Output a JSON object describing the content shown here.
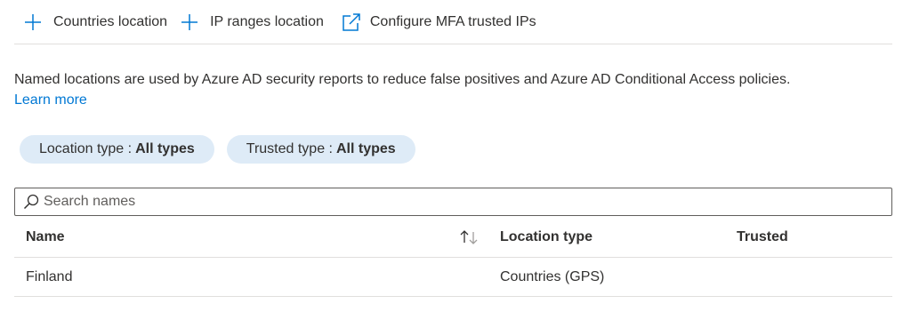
{
  "toolbar": {
    "countries_label": "Countries location",
    "ip_ranges_label": "IP ranges location",
    "mfa_label": "Configure MFA trusted IPs"
  },
  "description": {
    "text": "Named locations are used by Azure AD security reports to reduce false positives and Azure AD Conditional Access policies.",
    "learn_more": "Learn more"
  },
  "filters": {
    "location_type": {
      "label": "Location type :",
      "value": "All types"
    },
    "trusted_type": {
      "label": "Trusted type :",
      "value": "All types"
    }
  },
  "search": {
    "placeholder": "Search names",
    "value": ""
  },
  "table": {
    "columns": {
      "name": "Name",
      "location_type": "Location type",
      "trusted": "Trusted"
    },
    "rows": [
      {
        "name": "Finland",
        "location_type": "Countries (GPS)",
        "trusted": ""
      }
    ]
  },
  "colors": {
    "accent": "#0078d4",
    "pill_bg": "#deebf7",
    "divider": "#e1dfdd",
    "text": "#323130"
  },
  "icons": {
    "add": "plus-icon",
    "external": "external-link-icon",
    "search": "search-icon",
    "sort": "sort-up-down-icon"
  }
}
